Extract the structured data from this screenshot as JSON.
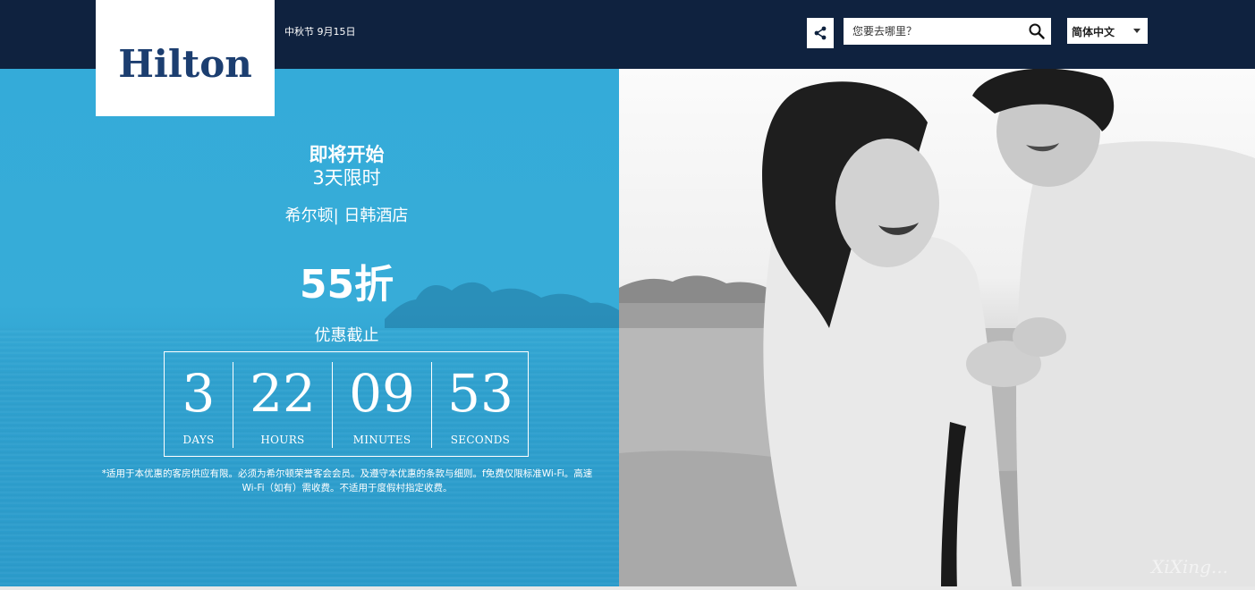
{
  "header": {
    "logo": "Hilton",
    "festival": "中秋节 9月15日",
    "search_placeholder": "您要去哪里？",
    "language": "简体中文"
  },
  "promo": {
    "headline1": "即将开始",
    "headline2": "3天限时",
    "brand_line": "希尔顿| 日韩酒店",
    "discount": "55折",
    "deadline_label": "优惠截止",
    "countdown": [
      {
        "value": "3",
        "unit": "DAYS"
      },
      {
        "value": "22",
        "unit": "HOURS"
      },
      {
        "value": "09",
        "unit": "MINUTES"
      },
      {
        "value": "53",
        "unit": "SECONDS"
      }
    ],
    "disclaimer": "*适用于本优惠的客房供应有限。必须为希尔顿荣誉客会会员。及遵守本优惠的条款与细则。f免费仅限标准Wi-Fi。高速Wi-Fi（如有）需收费。不适用于度假村指定收费。"
  },
  "colors": {
    "navy": "#0f223f",
    "cyan": "#34abd9",
    "logo_blue": "#1c3e70"
  },
  "icons": {
    "share": "share-icon",
    "search": "search-icon",
    "caret": "chevron-down-icon"
  }
}
